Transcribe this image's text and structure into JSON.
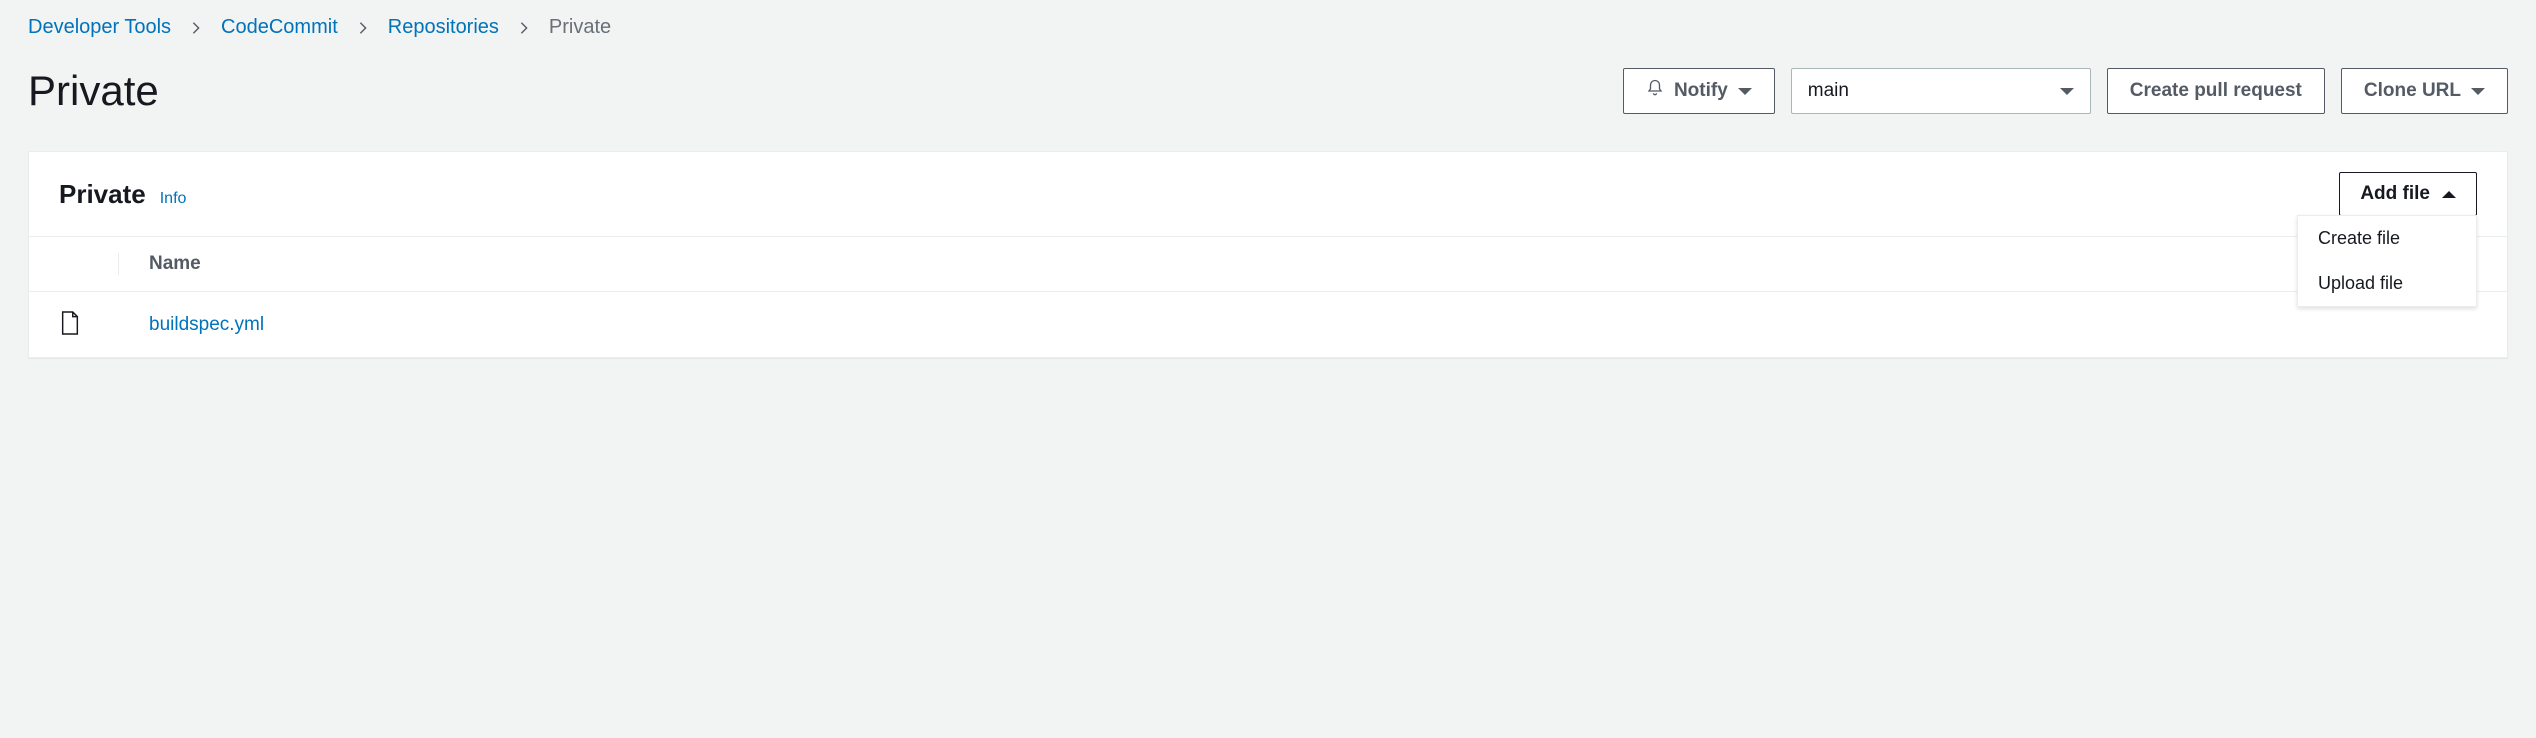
{
  "breadcrumb": {
    "items": [
      {
        "label": "Developer Tools"
      },
      {
        "label": "CodeCommit"
      },
      {
        "label": "Repositories"
      }
    ],
    "current": "Private"
  },
  "header": {
    "title": "Private",
    "notify_label": "Notify",
    "branch_value": "main",
    "create_pr_label": "Create pull request",
    "clone_url_label": "Clone URL"
  },
  "panel": {
    "title": "Private",
    "info_label": "Info",
    "add_file_label": "Add file",
    "add_file_menu": [
      {
        "label": "Create file"
      },
      {
        "label": "Upload file"
      }
    ],
    "columns": {
      "name": "Name"
    },
    "rows": [
      {
        "filename": "buildspec.yml"
      }
    ]
  }
}
